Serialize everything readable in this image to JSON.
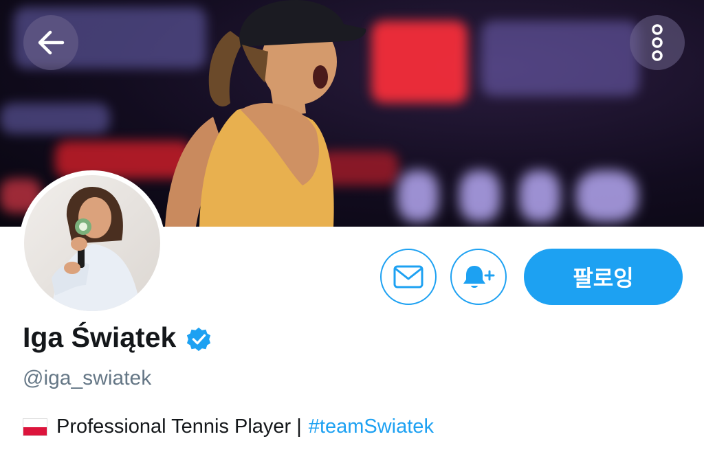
{
  "header": {
    "back_icon": "back-arrow-icon",
    "more_icon": "more-vertical-icon"
  },
  "profile": {
    "name": "Iga Świątek",
    "verified": true,
    "handle": "@iga_swiatek",
    "bio": {
      "flag_icon": "poland-flag-icon",
      "text": "Professional Tennis Player |",
      "hashtag": "#teamSwiatek"
    }
  },
  "actions": {
    "message_icon": "envelope-icon",
    "notify_icon": "bell-plus-icon",
    "follow_label": "팔로잉"
  },
  "colors": {
    "accent": "#1da1f2",
    "name_text": "#14171a",
    "secondary_text": "#657786"
  }
}
